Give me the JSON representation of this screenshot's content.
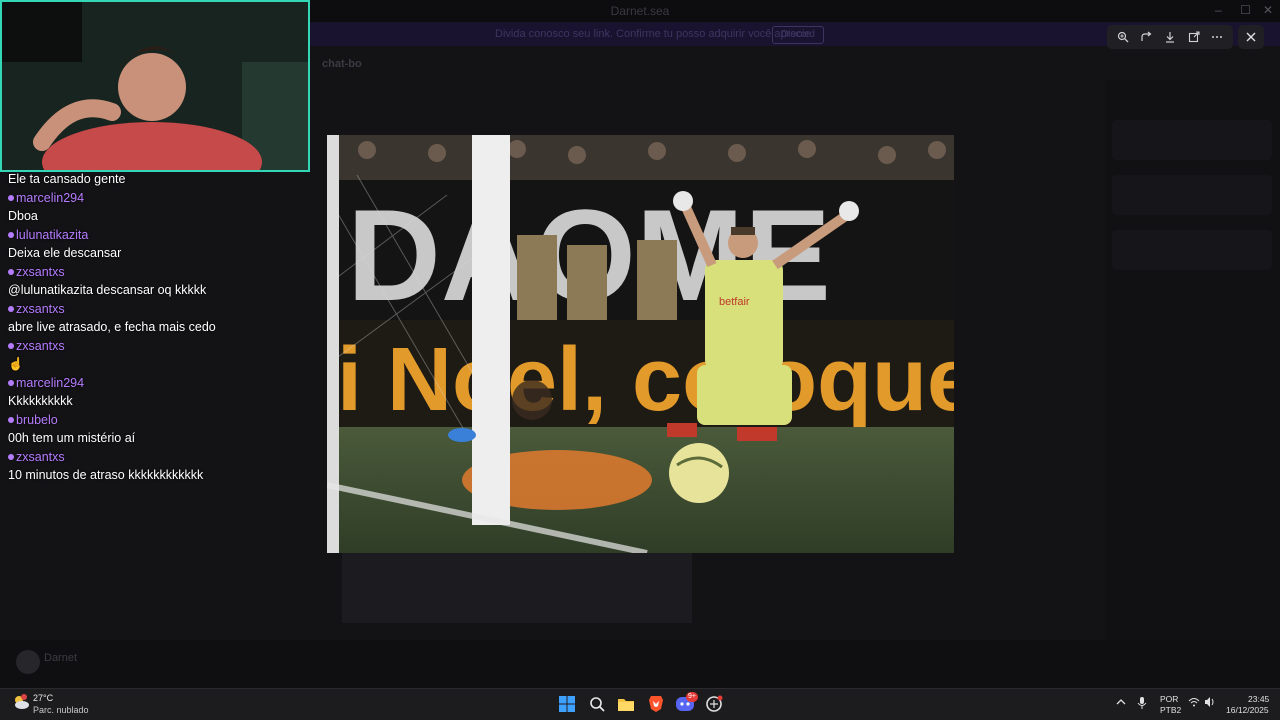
{
  "background_app": {
    "window_title": "Darnet.sea",
    "banner_text": "Divida conosco seu link. Confirme tu posso adquirir você aprecie.",
    "banner_button": "Discord",
    "channel_name": "chat-bo",
    "user_name": "Darnet"
  },
  "viewer_toolbar": {
    "zoom_icon": "zoom-in-icon",
    "rotate_icon": "rotate-icon",
    "download_icon": "download-icon",
    "open_icon": "open-external-icon",
    "more_icon": "more-icon",
    "close_icon": "close-icon"
  },
  "chat": {
    "lines": [
      {
        "type": "msg",
        "text": "Ele ta cansado gente"
      },
      {
        "type": "user",
        "text": "marcelin294"
      },
      {
        "type": "msg",
        "text": "Dboa"
      },
      {
        "type": "user",
        "text": "lulunatikazita"
      },
      {
        "type": "msg",
        "text": "Deixa ele descansar"
      },
      {
        "type": "user",
        "text": "zxsantxs"
      },
      {
        "type": "msg",
        "text": "@lulunatikazita descansar oq kkkkk"
      },
      {
        "type": "user",
        "text": "zxsantxs"
      },
      {
        "type": "msg",
        "text": "abre live atrasado, e fecha mais cedo"
      },
      {
        "type": "user",
        "text": "zxsantxs"
      },
      {
        "type": "msg",
        "text": "☝"
      },
      {
        "type": "user",
        "text": "marcelin294"
      },
      {
        "type": "msg",
        "text": "Kkkkkkkkkk"
      },
      {
        "type": "user",
        "text": "brubelo"
      },
      {
        "type": "msg",
        "text": "00h tem um mistério aí"
      },
      {
        "type": "user",
        "text": "zxsantxs"
      },
      {
        "type": "msg",
        "text": "10 minutos de atraso kkkkkkkkkkkk"
      }
    ]
  },
  "photo": {
    "banner_text": "i Noel, coloque",
    "sponsor_text": "betfair",
    "top_banner_text": "DAOME"
  },
  "taskbar": {
    "weather_temp": "27°C",
    "weather_desc": "Parc. nublado",
    "discord_badge": "9+",
    "lang_line1": "POR",
    "lang_line2": "PTB2",
    "time": "23:45",
    "date": "16/12/2025"
  },
  "colors": {
    "accent_webcam_border": "#34d6b8",
    "chat_username": "#b57cff",
    "discord": "#5865f2"
  }
}
